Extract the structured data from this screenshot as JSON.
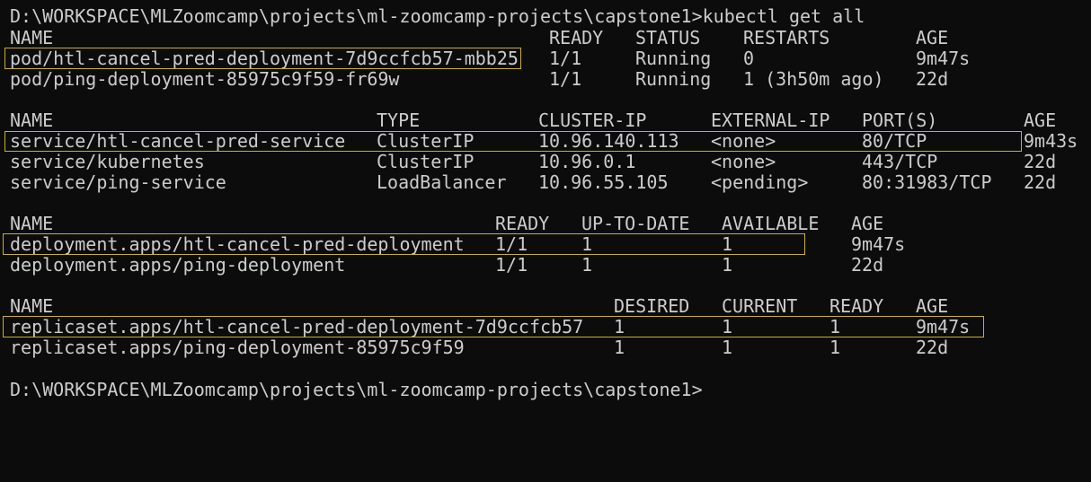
{
  "terminal": {
    "prompt_command": "D:\\WORKSPACE\\MLZoomcamp\\projects\\ml-zoomcamp-projects\\capstone1>kubectl get all",
    "final_prompt": "D:\\WORKSPACE\\MLZoomcamp\\projects\\ml-zoomcamp-projects\\capstone1>",
    "highlight_color": "#c8b028",
    "text_color": "#cccccc",
    "background_color": "#0c0c0c"
  },
  "pods": {
    "headers": [
      "NAME",
      "READY",
      "STATUS",
      "RESTARTS",
      "AGE"
    ],
    "rows": [
      [
        "pod/htl-cancel-pred-deployment-7d9ccfcb57-mbb25",
        "1/1",
        "Running",
        "0",
        "9m47s"
      ],
      [
        "pod/ping-deployment-85975c9f59-fr69w",
        "1/1",
        "Running",
        "1 (3h50m ago)",
        "22d"
      ]
    ]
  },
  "services": {
    "headers": [
      "NAME",
      "TYPE",
      "CLUSTER-IP",
      "EXTERNAL-IP",
      "PORT(S)",
      "AGE"
    ],
    "rows": [
      [
        "service/htl-cancel-pred-service",
        "ClusterIP",
        "10.96.140.113",
        "<none>",
        "80/TCP",
        "9m43s"
      ],
      [
        "service/kubernetes",
        "ClusterIP",
        "10.96.0.1",
        "<none>",
        "443/TCP",
        "22d"
      ],
      [
        "service/ping-service",
        "LoadBalancer",
        "10.96.55.105",
        "<pending>",
        "80:31983/TCP",
        "22d"
      ]
    ]
  },
  "deployments": {
    "headers": [
      "NAME",
      "READY",
      "UP-TO-DATE",
      "AVAILABLE",
      "AGE"
    ],
    "rows": [
      [
        "deployment.apps/htl-cancel-pred-deployment",
        "1/1",
        "1",
        "1",
        "9m47s"
      ],
      [
        "deployment.apps/ping-deployment",
        "1/1",
        "1",
        "1",
        "22d"
      ]
    ]
  },
  "replicasets": {
    "headers": [
      "NAME",
      "DESIRED",
      "CURRENT",
      "READY",
      "AGE"
    ],
    "rows": [
      [
        "replicaset.apps/htl-cancel-pred-deployment-7d9ccfcb57",
        "1",
        "1",
        "1",
        "9m47s"
      ],
      [
        "replicaset.apps/ping-deployment-85975c9f59",
        "1",
        "1",
        "1",
        "22d"
      ]
    ]
  }
}
